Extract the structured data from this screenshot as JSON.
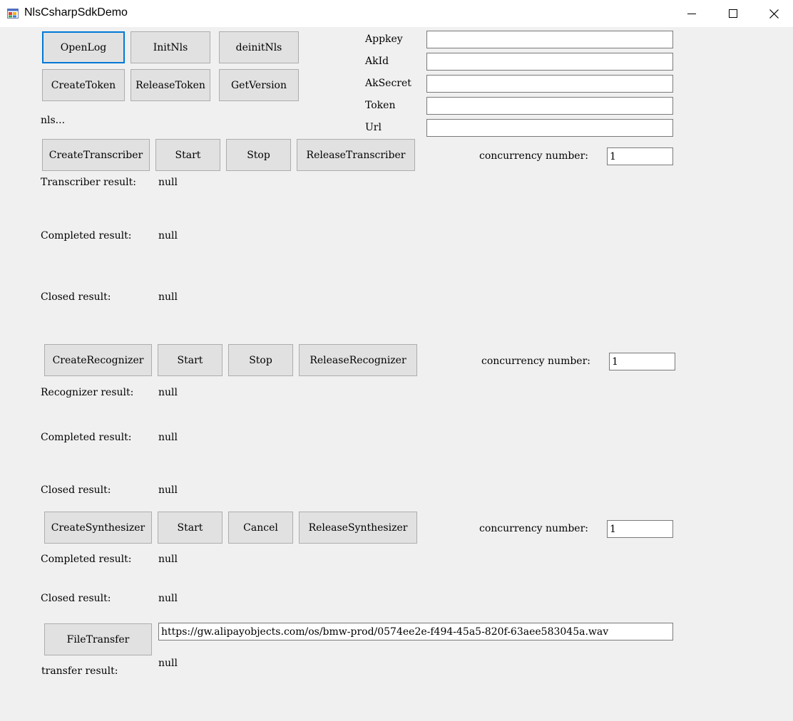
{
  "window": {
    "title": "NlsCsharpSdkDemo"
  },
  "top": {
    "buttons": {
      "open_log": "OpenLog",
      "init_nls": "InitNls",
      "deinit_nls": "deinitNls",
      "create_token": "CreateToken",
      "release_token": "ReleaseToken",
      "get_version": "GetVersion"
    },
    "status": "nls...",
    "fields": [
      {
        "label": "Appkey",
        "value": ""
      },
      {
        "label": "AkId",
        "value": ""
      },
      {
        "label": "AkSecret",
        "value": ""
      },
      {
        "label": "Token",
        "value": ""
      },
      {
        "label": "Url",
        "value": ""
      }
    ]
  },
  "transcriber": {
    "buttons": {
      "create": "CreateTranscriber",
      "start": "Start",
      "stop": "Stop",
      "release": "ReleaseTranscriber"
    },
    "concurrency_label": "concurrency number:",
    "concurrency_value": "1",
    "results": [
      {
        "label": "Transcriber result:",
        "value": "null"
      },
      {
        "label": "Completed result:",
        "value": "null"
      },
      {
        "label": "Closed result:",
        "value": "null"
      }
    ]
  },
  "recognizer": {
    "buttons": {
      "create": "CreateRecognizer",
      "start": "Start",
      "stop": "Stop",
      "release": "ReleaseRecognizer"
    },
    "concurrency_label": "concurrency number:",
    "concurrency_value": "1",
    "results": [
      {
        "label": "Recognizer result:",
        "value": "null"
      },
      {
        "label": "Completed result:",
        "value": "null"
      },
      {
        "label": "Closed result:",
        "value": "null"
      }
    ]
  },
  "synthesizer": {
    "buttons": {
      "create": "CreateSynthesizer",
      "start": "Start",
      "cancel": "Cancel",
      "release": "ReleaseSynthesizer"
    },
    "concurrency_label": "concurrency number:",
    "concurrency_value": "1",
    "results": [
      {
        "label": "Completed result:",
        "value": "null"
      },
      {
        "label": "Closed result:",
        "value": "null"
      }
    ]
  },
  "file_transfer": {
    "button": "FileTransfer",
    "url": "https://gw.alipayobjects.com/os/bmw-prod/0574ee2e-f494-45a5-820f-63aee583045a.wav",
    "result_label": "transfer result:",
    "result_value": "null"
  }
}
